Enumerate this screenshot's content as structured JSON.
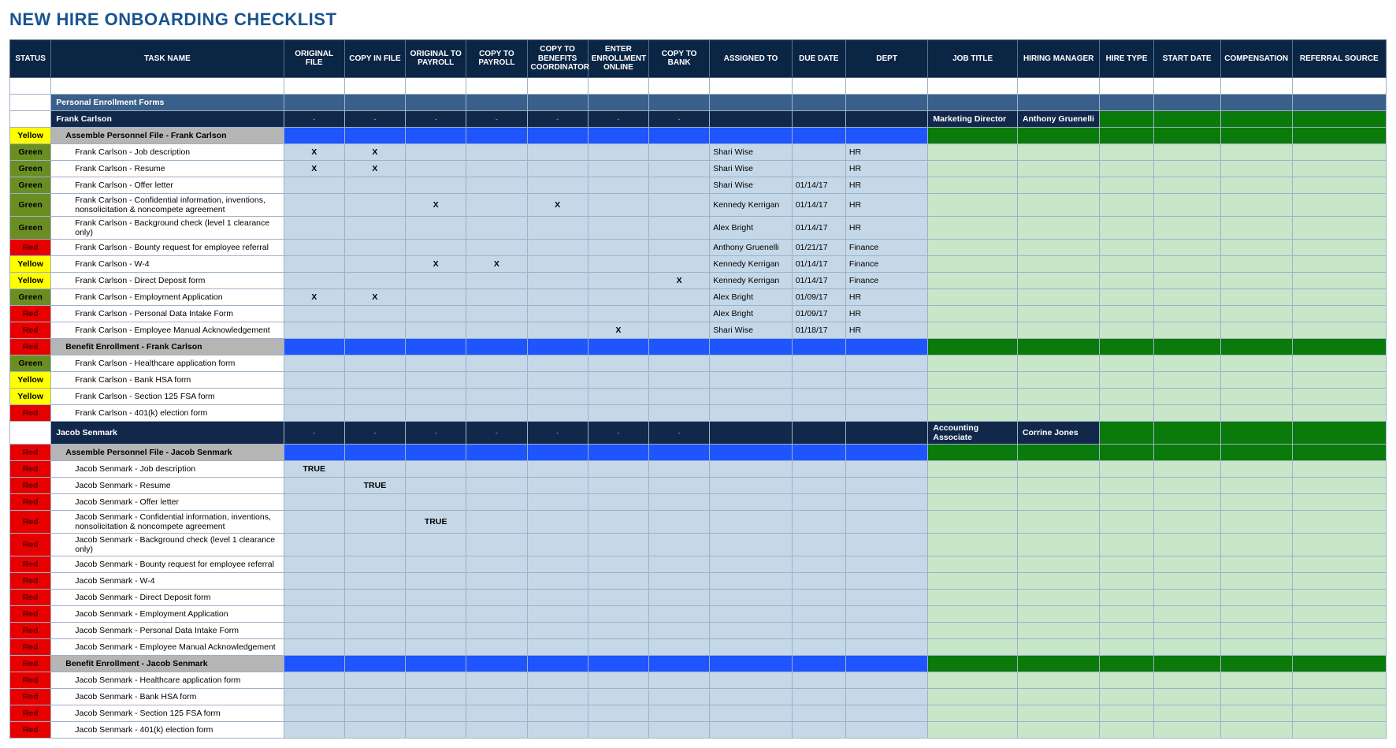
{
  "title": "NEW HIRE ONBOARDING CHECKLIST",
  "headers": [
    "STATUS",
    "TASK NAME",
    "ORIGINAL FILE",
    "COPY IN FILE",
    "ORIGINAL TO PAYROLL",
    "COPY TO PAYROLL",
    "COPY TO BENEFITS COORDINATOR",
    "ENTER ENROLLMENT ONLINE",
    "COPY TO BANK",
    "ASSIGNED TO",
    "DUE DATE",
    "DEPT",
    "JOB TITLE",
    "HIRING MANAGER",
    "HIRE TYPE",
    "START DATE",
    "COMPENSATION",
    "REFERRAL SOURCE"
  ],
  "rows": [
    {
      "kind": "blankrow"
    },
    {
      "kind": "section",
      "task": "Personal Enrollment Forms"
    },
    {
      "kind": "person",
      "task": "Frank Carlson",
      "jobtitle": "Marketing Director",
      "manager": "Anthony Gruenelli"
    },
    {
      "kind": "group",
      "status": "Yellow",
      "task": "Assemble Personnel File - Frank Carlson"
    },
    {
      "kind": "item",
      "status": "Green",
      "task": "Frank Carlson - Job description",
      "x": {
        "c2": "X",
        "c3": "X"
      },
      "assign": "Shari Wise",
      "date": "",
      "dept": "HR"
    },
    {
      "kind": "item",
      "status": "Green",
      "task": "Frank Carlson - Resume",
      "x": {
        "c2": "X",
        "c3": "X"
      },
      "assign": "Shari Wise",
      "date": "",
      "dept": "HR"
    },
    {
      "kind": "item",
      "status": "Green",
      "task": "Frank Carlson - Offer letter",
      "x": {},
      "assign": "Shari Wise",
      "date": "01/14/17",
      "dept": "HR"
    },
    {
      "kind": "item",
      "status": "Green",
      "task": "Frank Carlson - Confidential information, inventions, nonsolicitation & noncompete agreement",
      "x": {
        "c4": "X",
        "c6": "X"
      },
      "assign": "Kennedy Kerrigan",
      "date": "01/14/17",
      "dept": "HR"
    },
    {
      "kind": "item",
      "status": "Green",
      "task": "Frank Carlson - Background check (level 1 clearance only)",
      "x": {},
      "assign": "Alex Bright",
      "date": "01/14/17",
      "dept": "HR"
    },
    {
      "kind": "item",
      "status": "Red",
      "task": "Frank Carlson - Bounty request for employee referral",
      "x": {},
      "assign": "Anthony Gruenelli",
      "date": "01/21/17",
      "dept": "Finance"
    },
    {
      "kind": "item",
      "status": "Yellow",
      "task": "Frank Carlson - W-4",
      "x": {
        "c4": "X",
        "c5": "X"
      },
      "assign": "Kennedy Kerrigan",
      "date": "01/14/17",
      "dept": "Finance"
    },
    {
      "kind": "item",
      "status": "Yellow",
      "task": "Frank Carlson - Direct Deposit form",
      "x": {
        "c8": "X"
      },
      "assign": "Kennedy Kerrigan",
      "date": "01/14/17",
      "dept": "Finance"
    },
    {
      "kind": "item",
      "status": "Green",
      "task": "Frank Carlson - Employment Application",
      "x": {
        "c2": "X",
        "c3": "X"
      },
      "assign": "Alex Bright",
      "date": "01/09/17",
      "dept": "HR"
    },
    {
      "kind": "item",
      "status": "Red",
      "task": "Frank Carlson - Personal Data Intake Form",
      "x": {},
      "assign": "Alex Bright",
      "date": "01/09/17",
      "dept": "HR"
    },
    {
      "kind": "item",
      "status": "Red",
      "task": "Frank Carlson - Employee Manual Acknowledgement",
      "x": {
        "c7": "X"
      },
      "assign": "Shari Wise",
      "date": "01/18/17",
      "dept": "HR"
    },
    {
      "kind": "group",
      "status": "Red",
      "task": "Benefit Enrollment - Frank Carlson"
    },
    {
      "kind": "item",
      "status": "Green",
      "task": "Frank Carlson - Healthcare application form",
      "x": {},
      "assign": "",
      "date": "",
      "dept": ""
    },
    {
      "kind": "item",
      "status": "Yellow",
      "task": "Frank Carlson - Bank HSA form",
      "x": {},
      "assign": "",
      "date": "",
      "dept": ""
    },
    {
      "kind": "item",
      "status": "Yellow",
      "task": "Frank Carlson - Section 125 FSA form",
      "x": {},
      "assign": "",
      "date": "",
      "dept": ""
    },
    {
      "kind": "item",
      "status": "Red",
      "task": "Frank Carlson - 401(k) election form",
      "x": {},
      "assign": "",
      "date": "",
      "dept": ""
    },
    {
      "kind": "person",
      "task": "Jacob Senmark",
      "jobtitle": "Accounting Associate",
      "manager": "Corrine Jones"
    },
    {
      "kind": "group",
      "status": "Red",
      "task": "Assemble Personnel File - Jacob Senmark"
    },
    {
      "kind": "item",
      "status": "Red",
      "task": "Jacob Senmark - Job description",
      "x": {
        "c2": "TRUE"
      },
      "assign": "",
      "date": "",
      "dept": ""
    },
    {
      "kind": "item",
      "status": "Red",
      "task": "Jacob Senmark - Resume",
      "x": {
        "c3": "TRUE"
      },
      "assign": "",
      "date": "",
      "dept": ""
    },
    {
      "kind": "item",
      "status": "Red",
      "task": "Jacob Senmark - Offer letter",
      "x": {},
      "assign": "",
      "date": "",
      "dept": ""
    },
    {
      "kind": "item",
      "status": "Red",
      "task": "Jacob Senmark - Confidential information, inventions, nonsolicitation & noncompete agreement",
      "x": {
        "c4": "TRUE"
      },
      "assign": "",
      "date": "",
      "dept": ""
    },
    {
      "kind": "item",
      "status": "Red",
      "task": "Jacob Senmark - Background check (level 1 clearance only)",
      "x": {},
      "assign": "",
      "date": "",
      "dept": ""
    },
    {
      "kind": "item",
      "status": "Red",
      "task": "Jacob Senmark - Bounty request for employee referral",
      "x": {},
      "assign": "",
      "date": "",
      "dept": ""
    },
    {
      "kind": "item",
      "status": "Red",
      "task": "Jacob Senmark - W-4",
      "x": {},
      "assign": "",
      "date": "",
      "dept": ""
    },
    {
      "kind": "item",
      "status": "Red",
      "task": "Jacob Senmark - Direct Deposit form",
      "x": {},
      "assign": "",
      "date": "",
      "dept": ""
    },
    {
      "kind": "item",
      "status": "Red",
      "task": "Jacob Senmark - Employment Application",
      "x": {},
      "assign": "",
      "date": "",
      "dept": ""
    },
    {
      "kind": "item",
      "status": "Red",
      "task": "Jacob Senmark - Personal Data Intake Form",
      "x": {},
      "assign": "",
      "date": "",
      "dept": ""
    },
    {
      "kind": "item",
      "status": "Red",
      "task": "Jacob Senmark - Employee Manual Acknowledgement",
      "x": {},
      "assign": "",
      "date": "",
      "dept": ""
    },
    {
      "kind": "group",
      "status": "Red",
      "task": "Benefit Enrollment - Jacob Senmark"
    },
    {
      "kind": "item",
      "status": "Red",
      "task": "Jacob Senmark - Healthcare application form",
      "x": {},
      "assign": "",
      "date": "",
      "dept": ""
    },
    {
      "kind": "item",
      "status": "Red",
      "task": "Jacob Senmark - Bank HSA form",
      "x": {},
      "assign": "",
      "date": "",
      "dept": ""
    },
    {
      "kind": "item",
      "status": "Red",
      "task": "Jacob Senmark - Section 125 FSA form",
      "x": {},
      "assign": "",
      "date": "",
      "dept": ""
    },
    {
      "kind": "item",
      "status": "Red",
      "task": "Jacob Senmark - 401(k) election form",
      "x": {},
      "assign": "",
      "date": "",
      "dept": ""
    }
  ]
}
